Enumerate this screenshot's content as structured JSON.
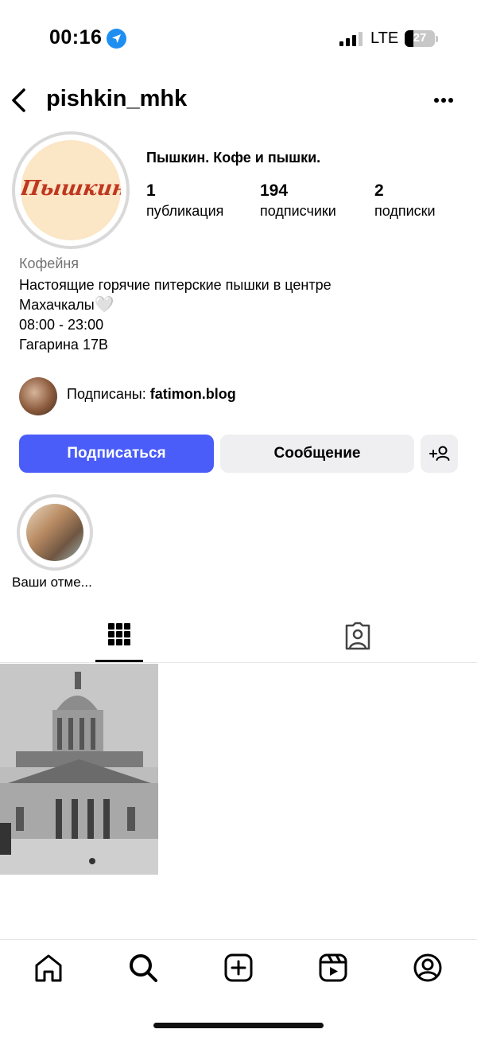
{
  "status_bar": {
    "time": "00:16",
    "network": "LTE",
    "battery": "27",
    "location_icon": "location-arrow-icon"
  },
  "header": {
    "username": "pishkin_mhk",
    "back_icon": "chevron-left-icon",
    "more_icon": "more-horizontal-icon"
  },
  "profile": {
    "avatar_logo": "Пышкин",
    "display_name": "Пышкин. Кофе и пышки.",
    "stats": [
      {
        "value": "1",
        "label": "публикация"
      },
      {
        "value": "194",
        "label": "подписчики"
      },
      {
        "value": "2",
        "label": "подписки"
      }
    ],
    "category": "Кофейня",
    "bio_line1": "Настоящие горячие питерские пышки в центре",
    "bio_line2": "Махачкалы",
    "bio_emoji": "🤍",
    "bio_line3": "08:00 - 23:00",
    "bio_line4": "Гагарина 17В",
    "followed_by_prefix": "Подписаны: ",
    "followed_by_user": "fatimon.blog"
  },
  "actions": {
    "follow_label": "Подписаться",
    "message_label": "Сообщение",
    "add_person_icon": "add-person-icon"
  },
  "highlights": [
    {
      "label": "Ваши отме..."
    }
  ],
  "tabs": [
    {
      "name": "grid",
      "icon": "grid-icon",
      "active": true
    },
    {
      "name": "tagged",
      "icon": "tagged-person-icon",
      "active": false
    }
  ],
  "bottom_nav": [
    "home-icon",
    "search-icon",
    "create-icon",
    "reels-icon",
    "profile-icon"
  ],
  "colors": {
    "accent": "#4a5df9",
    "button_secondary": "#efeff1",
    "muted_text": "#737373",
    "logo_red": "#c0361e",
    "logo_bg": "#fbe6c6"
  }
}
